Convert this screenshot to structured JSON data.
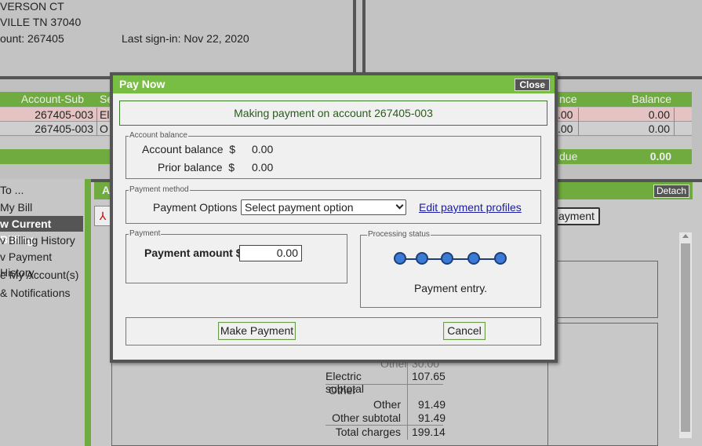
{
  "account_info": {
    "address_line1": "VERSON CT",
    "address_line2": "VILLE TN   37040",
    "account_label": "ount: 267405",
    "last_signin": "Last sign-in: Nov 22, 2020"
  },
  "accounts_table": {
    "headers": [
      "Account-Sub",
      "Se",
      "nce",
      "Balance"
    ],
    "rows": [
      {
        "account": "267405-003",
        "service": "El",
        "balance_due": ".00",
        "balance": "0.00"
      },
      {
        "account": "267405-003",
        "service": "O",
        "balance_due": ".00",
        "balance": "0.00"
      }
    ],
    "total_label": "due",
    "total_value": "0.00"
  },
  "side_menu": {
    "title": "To ...",
    "items": [
      "My Bill",
      "w Current Billing",
      "v Billing History",
      "v Payment History",
      "e My Account(s)",
      "& Notifications"
    ]
  },
  "content_panel": {
    "tab_label": "A",
    "detach_label": "Detach",
    "payment_btn": "ayment"
  },
  "bill_summary": {
    "rows": [
      {
        "label": "Other",
        "value": "30.00"
      },
      {
        "label": "Electric subtotal",
        "value": "107.65"
      },
      {
        "label": "Other",
        "value": ""
      },
      {
        "label": "Other",
        "value": "91.49"
      },
      {
        "label": "Other subtotal",
        "value": "91.49"
      },
      {
        "label": "Total charges",
        "value": "199.14"
      }
    ]
  },
  "modal": {
    "title": "Pay Now",
    "close_label": "Close",
    "banner": "Making payment on account 267405-003",
    "balance_legend": "Account balance",
    "account_balance_label": "Account balance  $",
    "account_balance_value": "0.00",
    "prior_balance_label": "Prior balance  $",
    "prior_balance_value": "0.00",
    "method_legend": "Payment method",
    "payment_options_label": "Payment Options",
    "payment_options_selected": "Select payment option",
    "edit_profiles_link": "Edit payment profiles",
    "payment_legend": "Payment",
    "payment_amount_label": "Payment amount $",
    "payment_amount_value": "0.00",
    "status_legend": "Processing status",
    "status_text": "Payment entry.",
    "make_payment_label": "Make Payment",
    "cancel_label": "Cancel",
    "colors": {
      "header": "#78bd44",
      "banner_border": "#3a7a2a",
      "dot": "#3b7bd6"
    }
  }
}
